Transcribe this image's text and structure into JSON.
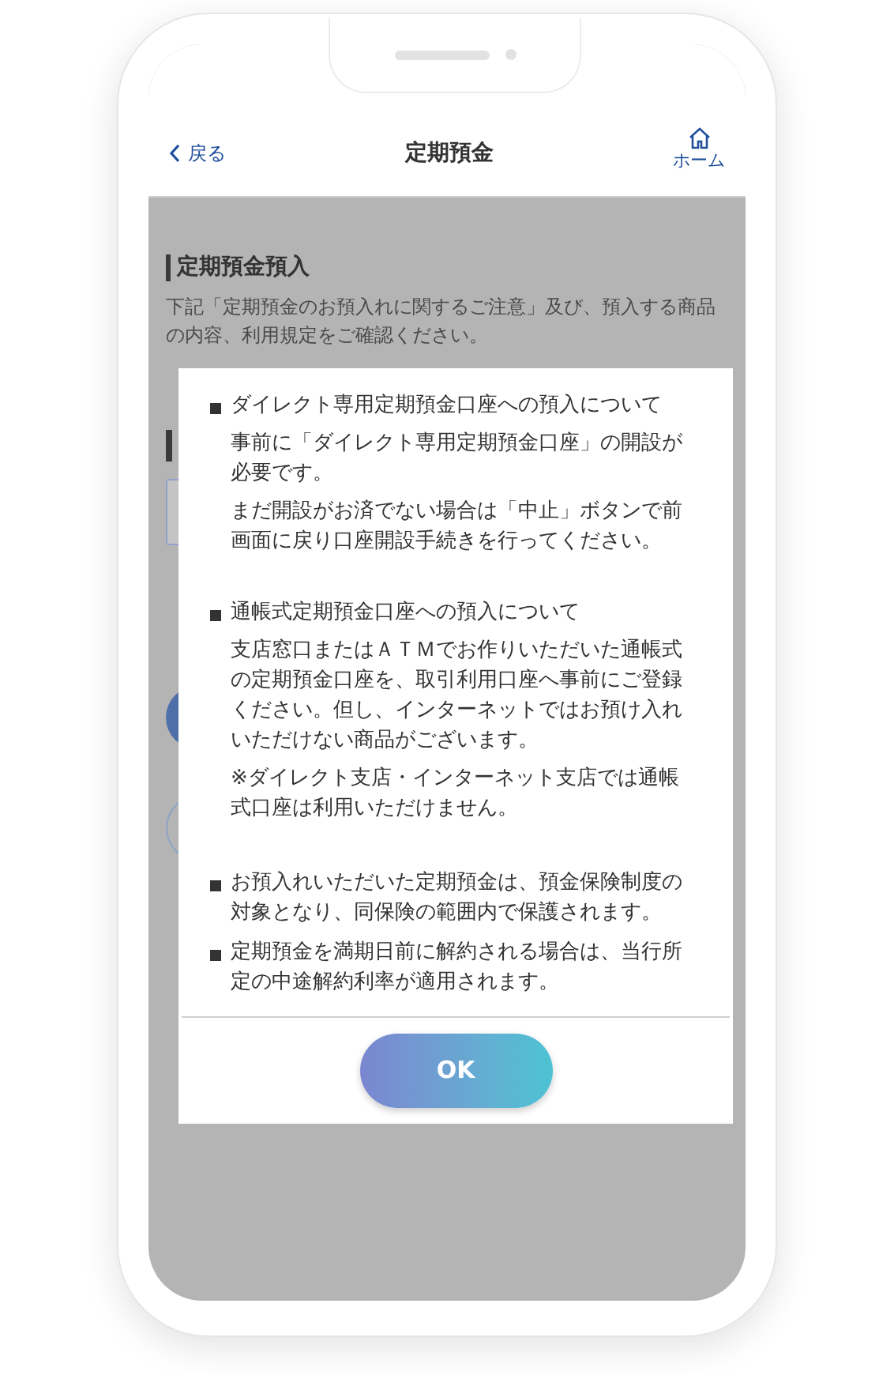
{
  "header": {
    "back_label": "戻る",
    "title": "定期預金",
    "home_label": "ホーム"
  },
  "page": {
    "heading": "定期預金預入",
    "intro": "下記「定期預金のお預入れに関するご注意」及び、預入する商品の内容、利用規定をご確認ください。"
  },
  "dialog": {
    "sections": [
      {
        "title": "ダイレクト専用定期預金口座への預入について",
        "paragraphs": [
          "事前に「ダイレクト専用定期預金口座」の開設が必要です。",
          "まだ開設がお済でない場合は「中止」ボタンで前画面に戻り口座開設手続きを行ってください。"
        ]
      },
      {
        "title": "通帳式定期預金口座への預入について",
        "paragraphs": [
          "支店窓口またはＡＴＭでお作りいただいた通帳式の定期預金口座を、取引利用口座へ事前にご登録ください。但し、インターネットではお預け入れいただけない商品がございます。",
          "※ダイレクト支店・インターネット支店では通帳式口座は利用いただけません。"
        ]
      },
      {
        "title": "お預入れいただいた定期預金は、預金保険制度の対象となり、同保険の範囲内で保護されます。"
      },
      {
        "title": "定期預金を満期日前に解約される場合は、当行所定の中途解約利率が適用されます。"
      }
    ],
    "ok_button": "OK"
  }
}
